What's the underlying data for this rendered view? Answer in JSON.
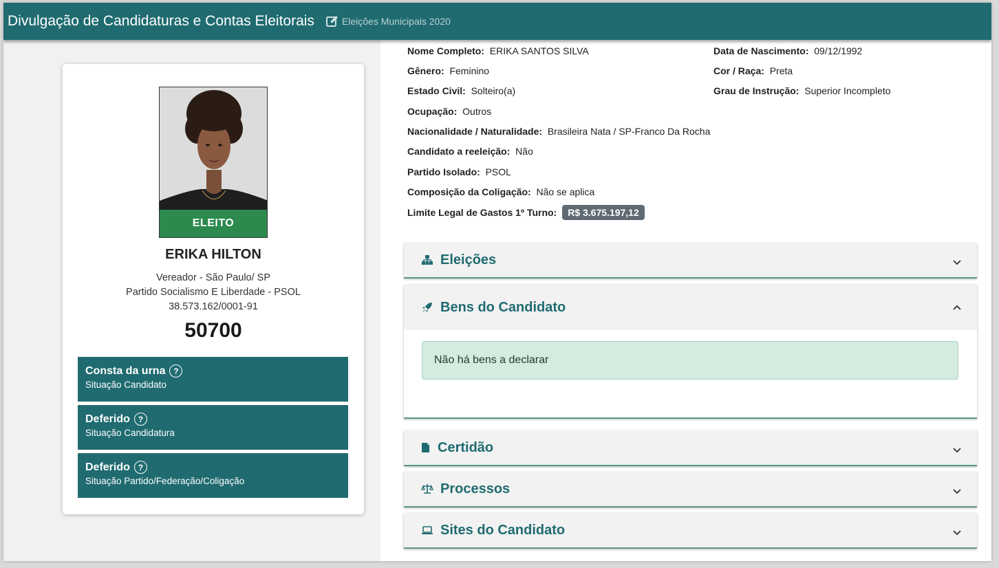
{
  "header": {
    "title": "Divulgação de Candidaturas e Contas Eleitorais",
    "subtitle": "Eleições Municipais 2020"
  },
  "candidate": {
    "status_label": "ELEITO",
    "name": "ERIKA HILTON",
    "office": "Vereador - São Paulo/ SP",
    "party": "Partido Socialismo E Liberdade - PSOL",
    "cnpj": "38.573.162/0001-91",
    "number": "50700"
  },
  "statuses": [
    {
      "title": "Consta da urna",
      "subtitle": "Situação Candidato"
    },
    {
      "title": "Deferido",
      "subtitle": "Situação Candidatura"
    },
    {
      "title": "Deferido",
      "subtitle": "Situação Partido/Federação/Coligação"
    }
  ],
  "details": {
    "nome_completo": {
      "label": "Nome Completo:",
      "value": "ERIKA SANTOS SILVA"
    },
    "data_nascimento": {
      "label": "Data de Nascimento:",
      "value": "09/12/1992"
    },
    "genero": {
      "label": "Gênero:",
      "value": "Feminino"
    },
    "cor_raca": {
      "label": "Cor / Raça:",
      "value": "Preta"
    },
    "estado_civil": {
      "label": "Estado Civil:",
      "value": "Solteiro(a)"
    },
    "grau_instrucao": {
      "label": "Grau de Instrução:",
      "value": "Superior Incompleto"
    },
    "ocupacao": {
      "label": "Ocupação:",
      "value": "Outros"
    },
    "nacionalidade": {
      "label": "Nacionalidade / Naturalidade:",
      "value": "Brasileira Nata / SP-Franco Da Rocha"
    },
    "reeleicao": {
      "label": "Candidato a reeleição:",
      "value": "Não"
    },
    "partido_isolado": {
      "label": "Partido Isolado:",
      "value": "PSOL"
    },
    "composicao": {
      "label": "Composição da Coligação:",
      "value": "Não se aplica"
    },
    "limite_gastos": {
      "label": "Limite Legal de Gastos 1º Turno:",
      "value": "R$ 3.675.197,12"
    }
  },
  "accordion": {
    "eleicoes": {
      "label": "Eleições",
      "icon": "sitemap-icon",
      "expanded": false
    },
    "bens": {
      "label": "Bens do Candidato",
      "icon": "rocket-icon",
      "expanded": true,
      "message": "Não há bens a declarar"
    },
    "certidao": {
      "label": "Certidão",
      "icon": "file-icon",
      "expanded": false
    },
    "processos": {
      "label": "Processos",
      "icon": "balance-scale-icon",
      "expanded": false
    },
    "sites": {
      "label": "Sites do Candidato",
      "icon": "laptop-icon",
      "expanded": false
    }
  },
  "colors": {
    "header": "#1f6b70",
    "elected": "#2c8a4e",
    "status_box": "#1f6b70",
    "accent": "#1f6b70",
    "alert_bg": "#d4ebe0",
    "badge": "#606a73"
  }
}
